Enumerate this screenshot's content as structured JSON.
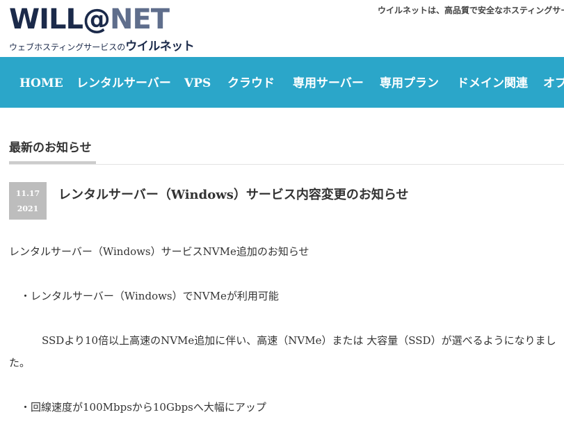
{
  "header": {
    "logo_main_a": "WILL@",
    "logo_main_b": "NET",
    "logo_sub": "ウェブホスティングサービスの",
    "logo_brand": "ウイルネット",
    "tagline": "ウイルネットは、高品質で安全なホスティングサー"
  },
  "nav": {
    "items": [
      "HOME",
      "レンタルサーバー",
      "VPS",
      "クラウド",
      "専用サーバー",
      "専用プラン",
      "ドメイン関連",
      "オプ"
    ]
  },
  "news": {
    "section_title": "最新のお知らせ",
    "date_day": "11.17",
    "date_year": "2021",
    "post_title": "レンタルサーバー（Windows）サービス内容変更のお知らせ",
    "paragraphs": [
      "レンタルサーバー（Windows）サービスNVMe追加のお知らせ",
      "・レンタルサーバー（Windows）でNVMeが利用可能",
      "SSDより10倍以上高速のNVMe追加に伴い、高速（NVMe）または 大容量（SSD）が選べるようになりました。",
      "・回線速度が100Mbpsから10Gbpsへ大幅にアップ"
    ]
  },
  "colors": {
    "nav_bg": "#2ba6c9",
    "logo_dark": "#1b2a4a",
    "logo_light": "#5f6e8c",
    "badge_bg": "#bdbdbd"
  }
}
